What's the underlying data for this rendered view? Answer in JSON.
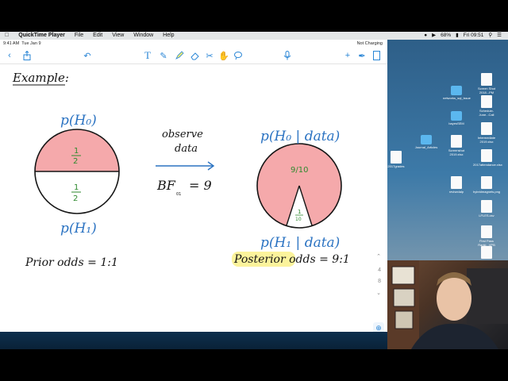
{
  "menubar": {
    "app": "QuickTime Player",
    "items": [
      "File",
      "Edit",
      "View",
      "Window",
      "Help"
    ],
    "battery": "68%",
    "clock": "Fri 09:51"
  },
  "device": {
    "time": "9:41 AM",
    "date": "Tue Jan 9",
    "battery": "Not Charging"
  },
  "toolbar_icons": [
    "back-icon",
    "share-icon",
    "undo-icon",
    "text-tool-icon",
    "pen-icon",
    "highlighter-icon",
    "eraser-icon",
    "scissors-icon",
    "hand-icon",
    "lasso-icon",
    "microphone-icon",
    "add-icon",
    "pen-settings-icon",
    "page-view-icon"
  ],
  "notes": {
    "heading": "Example:",
    "prior": {
      "label_h0": "p(H₀)",
      "label_h1": "p(H₁)",
      "top_fraction": {
        "num": "1",
        "den": "2"
      },
      "bottom_fraction": {
        "num": "1",
        "den": "2"
      },
      "odds": "Prior odds = 1:1"
    },
    "arrow": {
      "label_line1": "observe",
      "label_line2": "data",
      "bf": "BF",
      "bf_sub": "01",
      "bf_value": "= 9"
    },
    "posterior": {
      "label_h0": "p(H₀ | data)",
      "label_h1": "p(H₁ | data)",
      "big_fraction": "9/10",
      "small_fraction": {
        "num": "1",
        "den": "10"
      },
      "odds": "Posterior odds = 9:1"
    },
    "pages": [
      "4",
      "8"
    ]
  },
  "colors": {
    "ink_blue": "#2b73c2",
    "ink_black": "#151515",
    "ink_green": "#2f8a2f",
    "pie_pink": "#f5a9ab",
    "highlight": "#fbf39c"
  },
  "desktop": {
    "icons": [
      {
        "label": "Screen Shot 2018...PM",
        "kind": "file"
      },
      {
        "label": "networks_sql_issue",
        "kind": "folder"
      },
      {
        "label": "Schedule-June...Call",
        "kind": "file"
      },
      {
        "label": "bayesSEM",
        "kind": "folder"
      },
      {
        "label": "Intermediate 2019.xlsx",
        "kind": "file"
      },
      {
        "label": "Journal_Articles",
        "kind": "folder"
      },
      {
        "label": "Screenshot 2019.xlsx",
        "kind": "file"
      },
      {
        "label": "2017grades",
        "kind": "file"
      },
      {
        "label": "2017attendance.xlsx",
        "kind": "file"
      },
      {
        "label": "revisedalp",
        "kind": "file"
      },
      {
        "label": "hybridmagnets.png",
        "kind": "file"
      },
      {
        "label": "LFLES.csv",
        "kind": "file"
      },
      {
        "label": "First Pass Ranki...VPB",
        "kind": "file"
      },
      {
        "label": "COST 1000 and 2...xlsx",
        "kind": "file"
      },
      {
        "label": "thesisParam",
        "kind": "file"
      },
      {
        "label": "GEAAC",
        "kind": "folder"
      }
    ]
  }
}
